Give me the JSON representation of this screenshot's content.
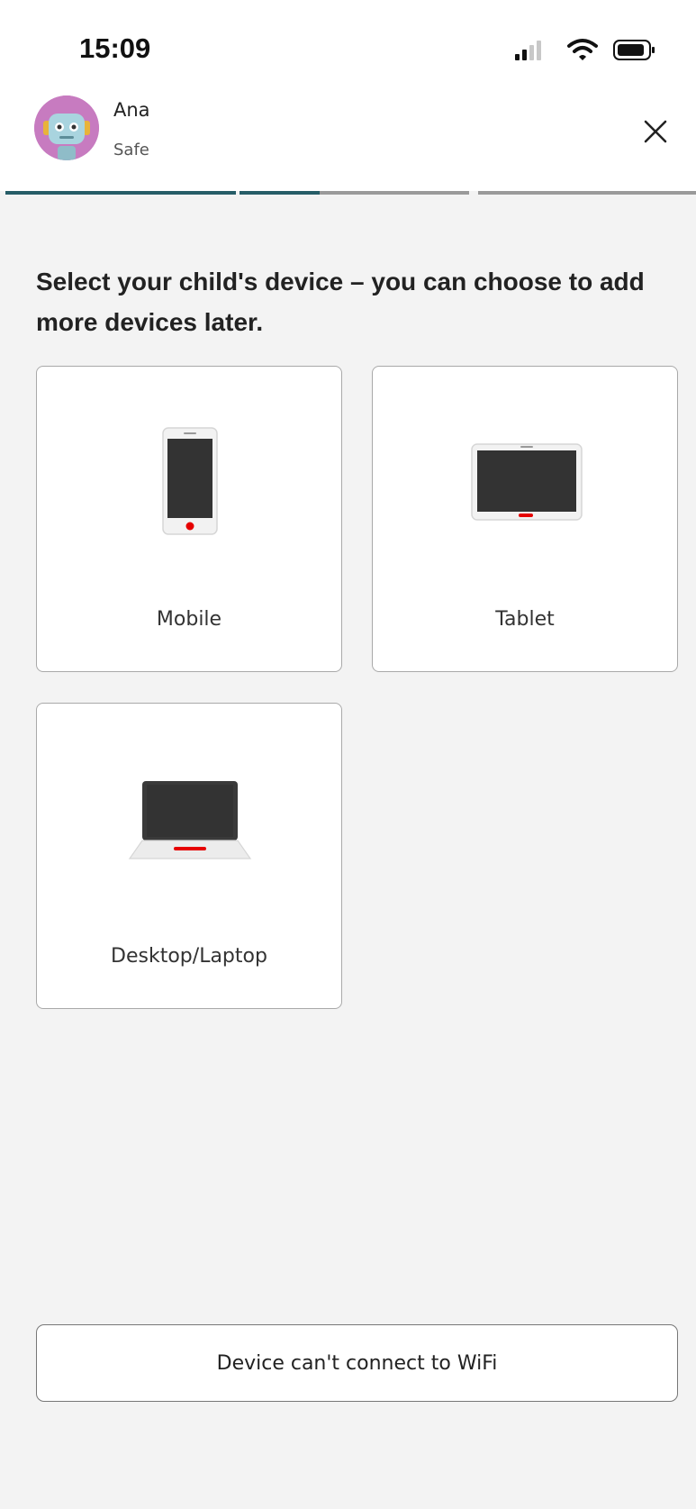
{
  "status_bar": {
    "time": "15:09",
    "icons": [
      "cellular-signal-icon",
      "wifi-icon",
      "battery-icon"
    ]
  },
  "profile": {
    "name": "Ana",
    "status": "Safe",
    "avatar_icon": "robot-avatar-icon",
    "close_icon": "close-icon"
  },
  "progress": {
    "total_steps": 3,
    "current_step_fill": 0.35
  },
  "main": {
    "prompt": "Select your child's device – you can choose to add more devices later.",
    "devices": [
      {
        "label": "Mobile",
        "icon": "mobile-phone-icon"
      },
      {
        "label": "Tablet",
        "icon": "tablet-icon"
      },
      {
        "label": "Desktop/Laptop",
        "icon": "laptop-icon"
      }
    ]
  },
  "footer": {
    "wifi_button_label": "Device can't connect to WiFi"
  },
  "colors": {
    "background": "#f3f3f3",
    "progress_active": "#265d67",
    "progress_inactive": "#9a9a9a",
    "accent_red": "#e60000",
    "device_screen": "#333333"
  }
}
